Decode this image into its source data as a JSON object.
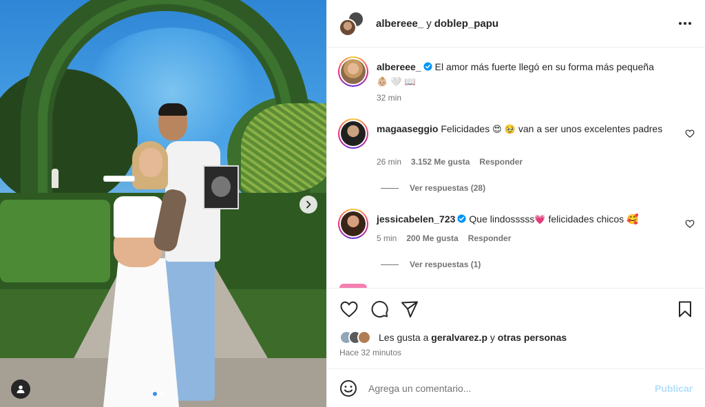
{
  "header": {
    "user_a": "albereee_",
    "connector": "y",
    "user_b": "doblep_papu"
  },
  "caption": {
    "username": "albereee_",
    "text": "El amor más fuerte llegó en su forma más pequeña",
    "emojis": "👶🏼 🤍 📖",
    "time": "32 min"
  },
  "comments": [
    {
      "username": "magaaseggio",
      "text_before": "Felicidades",
      "emojis": "😍 🥹",
      "text_after": "van a ser unos excelentes padres",
      "time": "26 min",
      "likes": "3.152 Me gusta",
      "reply_label": "Responder",
      "view_replies": "Ver respuestas (28)",
      "verified": false
    },
    {
      "username": "jessicabelen_723",
      "text_before": "Que lindosssss",
      "emojis": "💗",
      "text_after": "felicidades chicos 🥰",
      "time": "5 min",
      "likes": "200 Me gusta",
      "reply_label": "Responder",
      "view_replies": "Ver respuestas (1)",
      "verified": true
    }
  ],
  "likes_summary": {
    "prefix": "Les gusta a",
    "user": "geralvarez.p",
    "connector": "y",
    "others": "otras personas"
  },
  "posted_ago": "Hace 32 minutos",
  "comment_box": {
    "placeholder": "Agrega un comentario...",
    "publish_label": "Publicar"
  },
  "icons": {
    "like": "heart-icon",
    "comment": "comment-icon",
    "share": "send-icon",
    "save": "bookmark-icon",
    "emoji": "smiley-icon",
    "more": "more-icon",
    "next": "chevron-right-icon",
    "tag": "person-icon"
  },
  "colors": {
    "verified": "#0095f6",
    "publish_disabled": "#b2dffc",
    "secondary_text": "#737373"
  },
  "carousel": {
    "total_slides": 2,
    "active_slide": 1
  }
}
